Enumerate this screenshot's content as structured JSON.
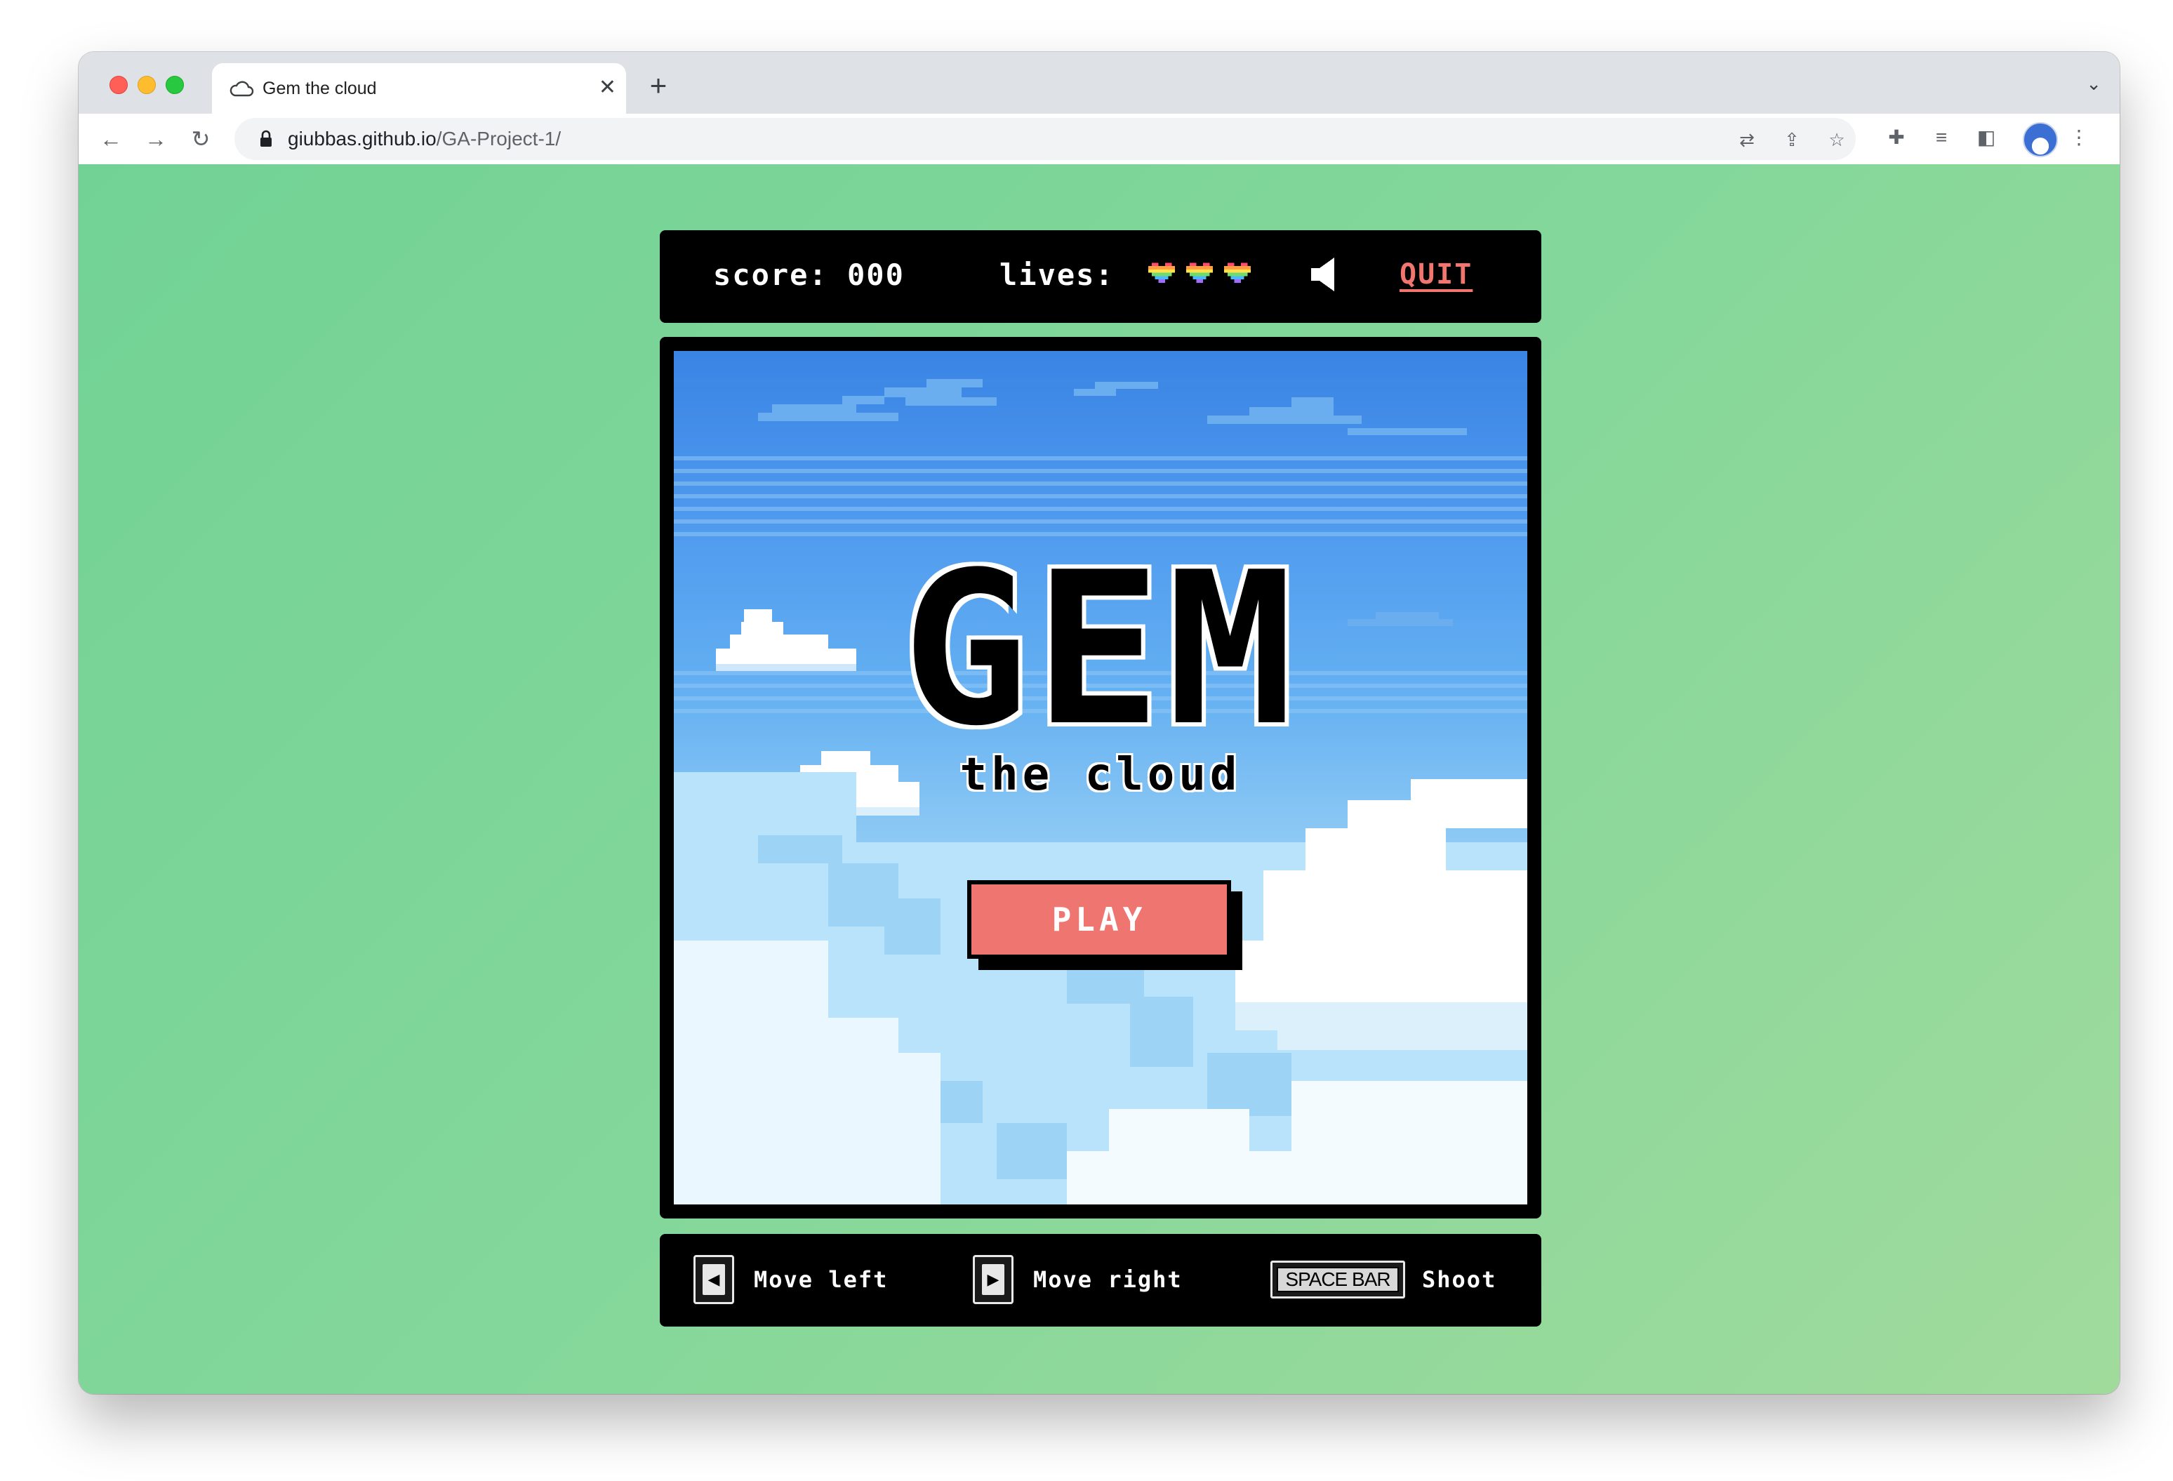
{
  "browser": {
    "tab_title": "Gem the cloud",
    "url_domain": "giubbas.github.io",
    "url_path": "/GA-Project-1/",
    "new_tab_label": "+"
  },
  "hud": {
    "score_label": "score: 000",
    "lives_label": "lives:",
    "lives_count": 3,
    "quit_label": "QUIT"
  },
  "game": {
    "logo": "GEM",
    "subtitle": "the cloud",
    "play_label": "PLAY"
  },
  "controls": [
    {
      "key": "left-arrow",
      "label": "Move left"
    },
    {
      "key": "right-arrow",
      "label": "Move right"
    },
    {
      "key": "SPACE BAR",
      "label": "Shoot"
    }
  ],
  "colors": {
    "background": "#7ad497",
    "accent": "#ee7570",
    "panel": "#000000"
  }
}
